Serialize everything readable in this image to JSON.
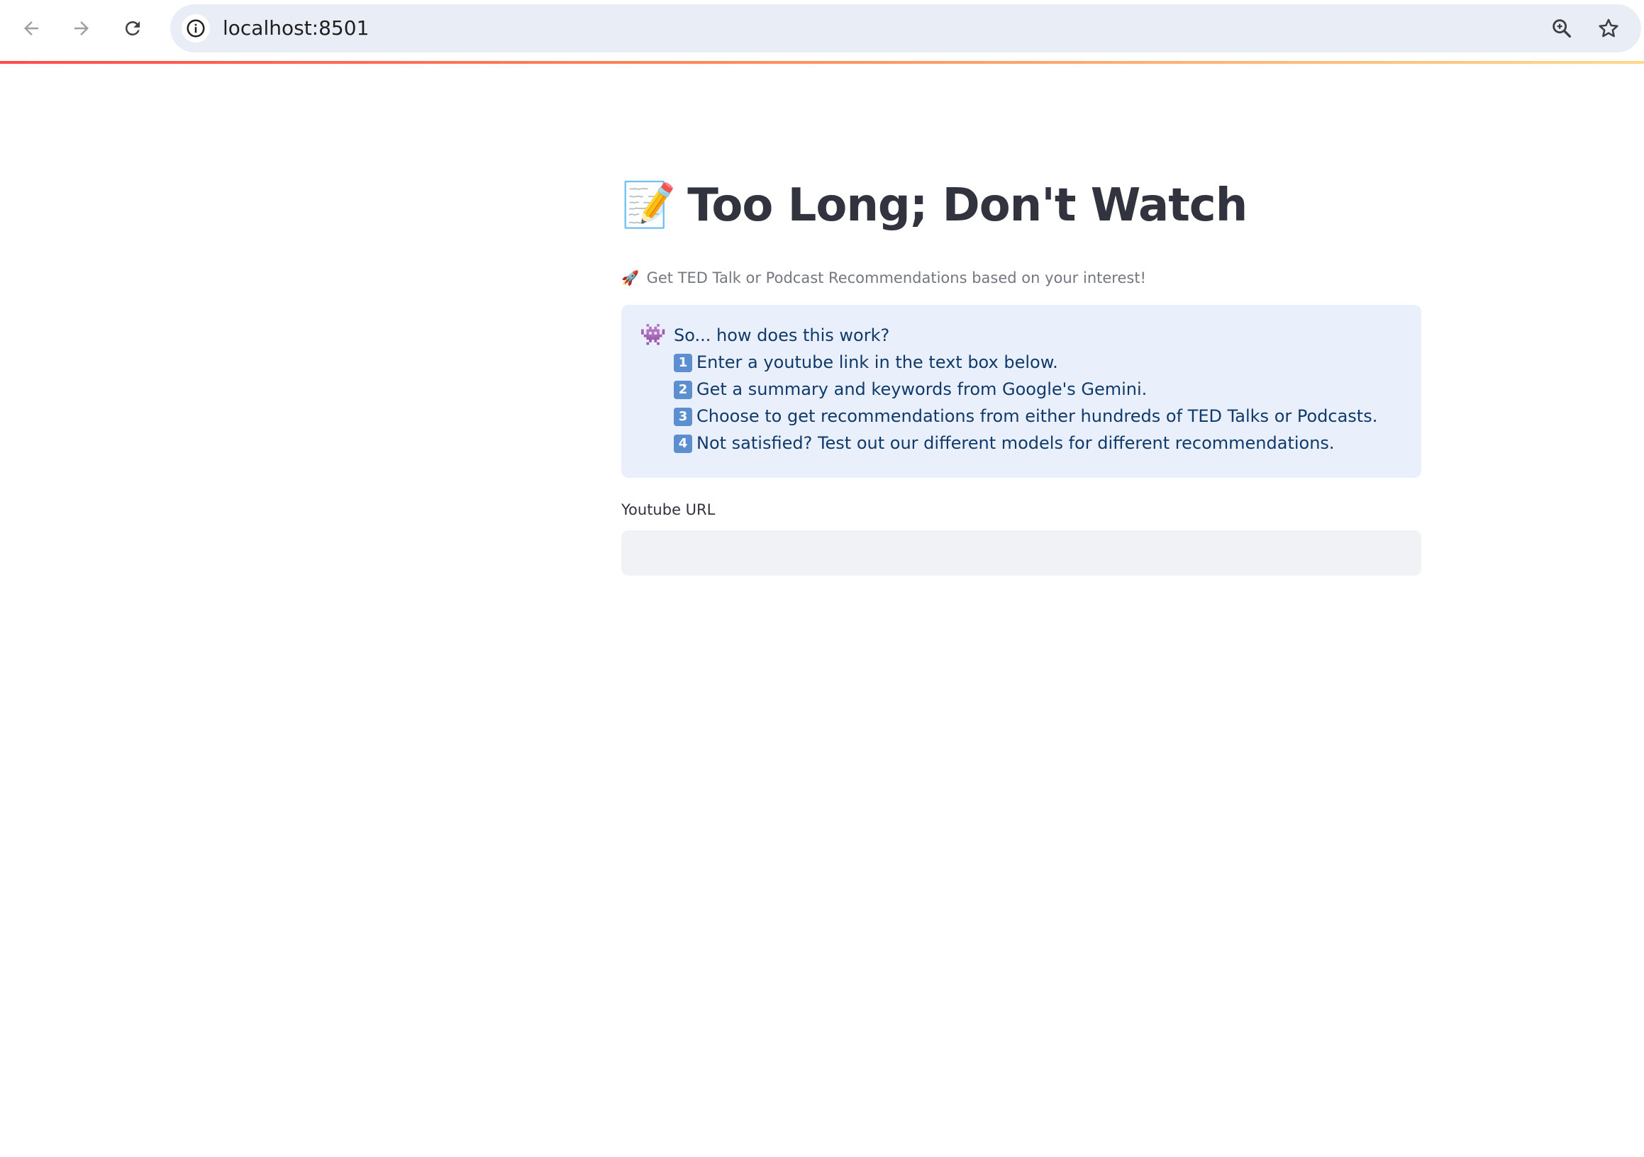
{
  "browser": {
    "url": "localhost:8501",
    "back_icon": "arrow-left-icon",
    "forward_icon": "arrow-right-icon",
    "reload_icon": "reload-icon",
    "info_icon": "info-icon",
    "zoom_icon": "magnifier-icon",
    "bookmark_icon": "star-icon"
  },
  "page": {
    "title_emoji": "📝",
    "title": "Too Long; Don't Watch",
    "subtitle_emoji": "🚀",
    "subtitle": "Get TED Talk or Podcast Recommendations based on your interest!",
    "info_box": {
      "icon": "👾",
      "heading": "So... how does this work?",
      "steps": [
        {
          "num": "1",
          "text": "Enter a youtube link in the text box below."
        },
        {
          "num": "2",
          "text": "Get a summary and keywords from Google's Gemini."
        },
        {
          "num": "3",
          "text": "Choose to get recommendations from either hundreds of TED Talks or Podcasts."
        },
        {
          "num": "4",
          "text": "Not satisfied? Test out our different models for different recommendations."
        }
      ]
    },
    "url_field": {
      "label": "Youtube URL",
      "value": "",
      "placeholder": ""
    }
  },
  "colors": {
    "accent": "#ff4b4b",
    "info_bg": "#e9f0fb",
    "info_text": "#0f3a6b",
    "title_text": "#31333f"
  }
}
